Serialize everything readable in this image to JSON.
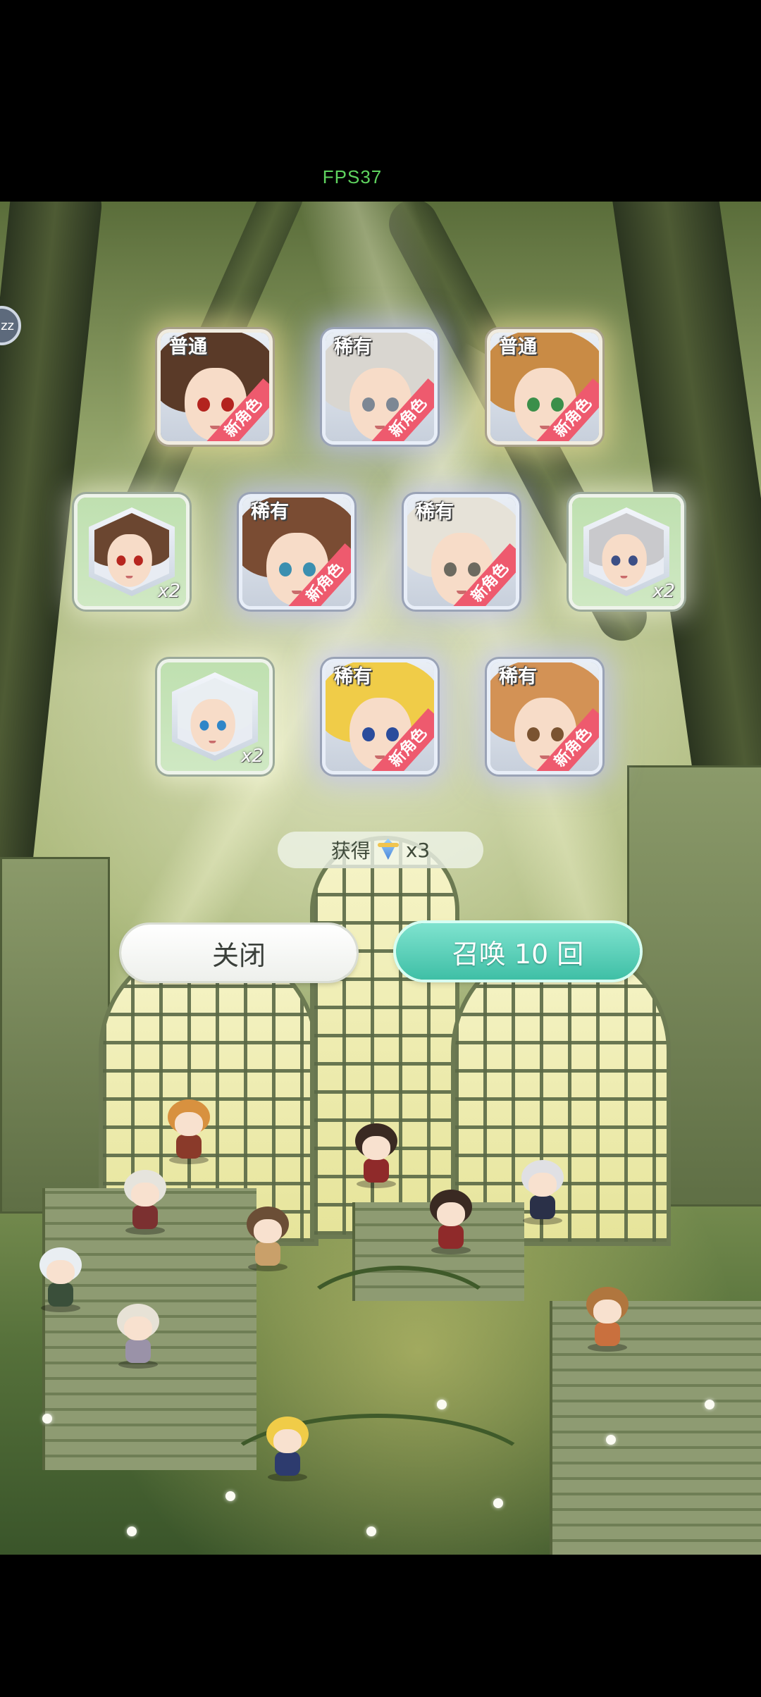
{
  "status": {
    "fps_label": "FPS37"
  },
  "side_badge": {
    "label": "zz"
  },
  "cards": [
    {
      "rarity": "普通",
      "new_tag": "新角色",
      "hair": "#5a3a28",
      "eyes": "#b3241f",
      "frame": "gold",
      "duplicate": false
    },
    {
      "rarity": "稀有",
      "new_tag": "新角色",
      "hair": "#d9d6d0",
      "eyes": "#7c8794",
      "frame": "blue",
      "duplicate": false
    },
    {
      "rarity": "普通",
      "new_tag": "新角色",
      "hair": "#c98b45",
      "eyes": "#3b8f4a",
      "frame": "gold",
      "duplicate": false
    },
    {
      "count": "x2",
      "hair": "#6b4630",
      "eyes": "#b7261f",
      "frame": "dup",
      "duplicate": true
    },
    {
      "rarity": "稀有",
      "new_tag": "新角色",
      "hair": "#7a4c33",
      "eyes": "#3b8fb0",
      "frame": "blue",
      "duplicate": false
    },
    {
      "rarity": "稀有",
      "new_tag": "新角色",
      "hair": "#e6e2d8",
      "eyes": "#6c6a60",
      "frame": "blue",
      "duplicate": false
    },
    {
      "count": "x2",
      "hair": "#c9c9cc",
      "eyes": "#3c4f86",
      "frame": "dup",
      "duplicate": true
    },
    {
      "count": "x2",
      "hair": "#e9eef2",
      "eyes": "#2f86c8",
      "frame": "dup",
      "duplicate": true
    },
    {
      "rarity": "稀有",
      "new_tag": "新角色",
      "hair": "#f0cc48",
      "eyes": "#2a4c9c",
      "frame": "blue",
      "duplicate": false
    },
    {
      "rarity": "稀有",
      "new_tag": "新角色",
      "hair": "#d39255",
      "eyes": "#7a5331",
      "frame": "blue",
      "duplicate": false
    }
  ],
  "reward": {
    "label": "获得",
    "icon": "summon-crystal-icon",
    "count": "x3"
  },
  "buttons": {
    "close": "关闭",
    "summon": "召唤 10 回"
  },
  "colors": {
    "accent": "#3fbfa6",
    "new_tag": "#ee5a6e",
    "fps": "#5fd35f"
  },
  "chibis": [
    {
      "hair": "#d8913f",
      "body": "#8a3a2a"
    },
    {
      "hair": "#e6e4dd",
      "body": "#7b3030"
    },
    {
      "hair": "#6b4e36",
      "body": "#c9a06a"
    },
    {
      "hair": "#e9eef2",
      "body": "#3a4f3a"
    },
    {
      "hair": "#e7e2d6",
      "body": "#9a92a8"
    },
    {
      "hair": "#3a2a22",
      "body": "#8f2a2a"
    },
    {
      "hair": "#3a2a22",
      "body": "#8f2a2a"
    },
    {
      "hair": "#e0e0e4",
      "body": "#2a3048"
    },
    {
      "hair": "#b0763e",
      "body": "#c9703e"
    },
    {
      "hair": "#f0cc48",
      "body": "#2d3b6e"
    }
  ]
}
